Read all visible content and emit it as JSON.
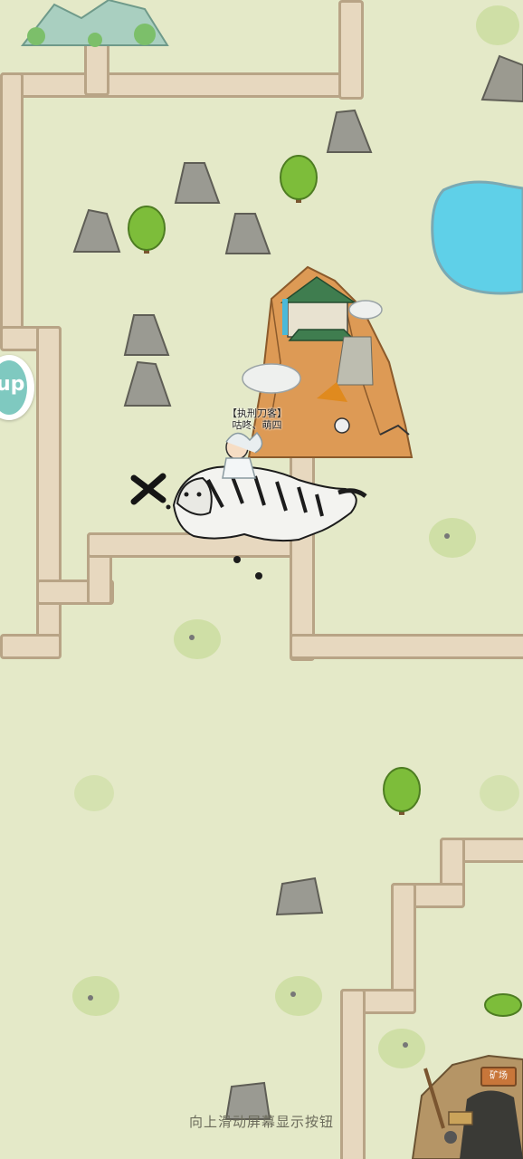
{
  "player": {
    "title": "【执刑刀客】",
    "name": "咕咚、萌四"
  },
  "hint": {
    "text": "向上滑动屏幕显示按钮"
  },
  "side_button": {
    "label": "up"
  },
  "mine": {
    "sign_text": "矿场"
  },
  "colors": {
    "ground": "#e4e9c8",
    "path_fill": "#e7d8bf",
    "path_border": "#b8a486",
    "lake": "#5fd0e8",
    "tree": "#7dbd3a",
    "rock": "#8f8f86"
  },
  "icons": [
    "close-x-icon",
    "tiger-mount-sprite",
    "mountain-temple",
    "lake",
    "tree-icon",
    "rock-icon",
    "grass-patch-icon",
    "mine-entrance"
  ]
}
